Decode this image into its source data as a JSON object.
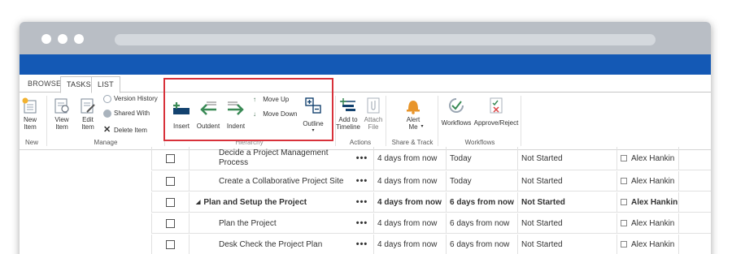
{
  "tabs": [
    "BROWSE",
    "TASKS",
    "LIST"
  ],
  "ribbon": {
    "new": {
      "new_item": "New\nItem"
    },
    "manage": {
      "view_item": "View\nItem",
      "edit_item": "Edit\nItem",
      "version_history": "Version History",
      "shared_with": "Shared With",
      "delete_item": "Delete Item"
    },
    "hierarchy": {
      "insert": "Insert",
      "outdent": "Outdent",
      "indent": "Indent",
      "move_up": "Move Up",
      "move_down": "Move Down",
      "outline": "Outline"
    },
    "actions": {
      "add_to_timeline": "Add to\nTimeline",
      "attach_file": "Attach\nFile"
    },
    "share_track": {
      "alert_me": "Alert\nMe"
    },
    "workflows": {
      "workflows": "Workflows",
      "approve_reject": "Approve/Reject"
    },
    "group_labels": {
      "new": "New",
      "manage": "Manage",
      "hierarchy": "Hierarchy",
      "actions": "Actions",
      "share_track": "Share & Track",
      "workflows": "Workflows"
    }
  },
  "tasks": [
    {
      "title": "Decide a Project Management Process",
      "start": "4 days from now",
      "due": "Today",
      "status": "Not Started",
      "assigned": "Alex Hankin",
      "bold": false
    },
    {
      "title": "Create a Collaborative Project Site",
      "start": "4 days from now",
      "due": "Today",
      "status": "Not Started",
      "assigned": "Alex Hankin",
      "bold": false
    },
    {
      "title": "Plan and Setup the Project",
      "start": "4 days from now",
      "due": "6 days from now",
      "status": "Not Started",
      "assigned": "Alex Hankin",
      "bold": true
    },
    {
      "title": "Plan the Project",
      "start": "4 days from now",
      "due": "6 days from now",
      "status": "Not Started",
      "assigned": "Alex Hankin",
      "bold": false
    },
    {
      "title": "Desk Check the Project Plan",
      "start": "4 days from now",
      "due": "6 days from now",
      "status": "Not Started",
      "assigned": "Alex Hankin",
      "bold": false
    }
  ],
  "colors": {
    "suite_bar": "#1459b5",
    "highlight": "#d8313a",
    "accent_green": "#3a8a56",
    "bell": "#e8952b"
  }
}
